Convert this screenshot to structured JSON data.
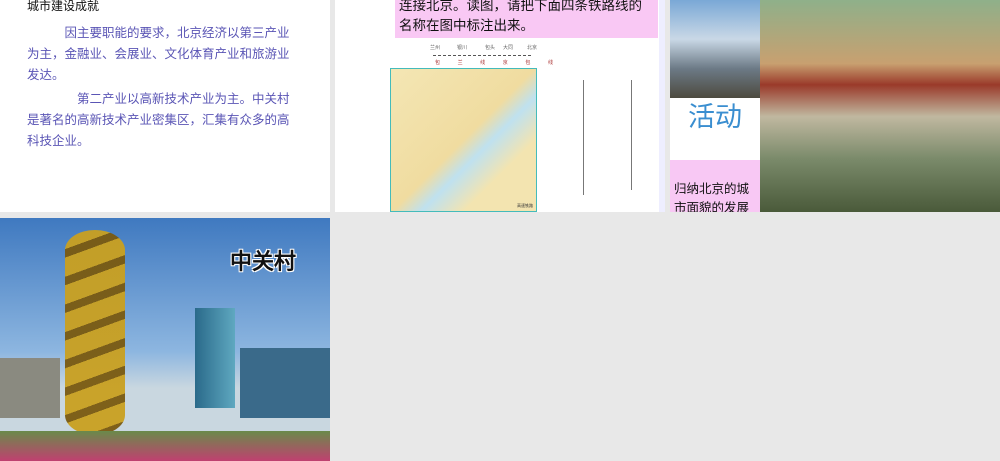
{
  "slide1": {
    "heading": "城市建设成就",
    "para1": "　　　因主要职能的要求，北京经济以第三产业为主，金融业、会展业、文化体育产业和旅游业发达。",
    "para2": "　　　　第二产业以高新技术产业为主。中关村是著名的高新技术产业密集区，汇集有众多的高科技企业。"
  },
  "slide2": {
    "instruction": "连接北京。读图，请把下面四条铁路线的名称在图中标注出来。",
    "route_stations": [
      "兰州",
      "银川",
      "包头",
      "大同",
      "北京"
    ],
    "route_label": "包 兰 线 京 包 线",
    "legend": "高速铁路"
  },
  "slide3": {
    "activity_title": "活动",
    "activity_text": "　　　　　　归纳北京的城市面貌的发展特"
  },
  "slide4": {
    "title": "中关村"
  }
}
